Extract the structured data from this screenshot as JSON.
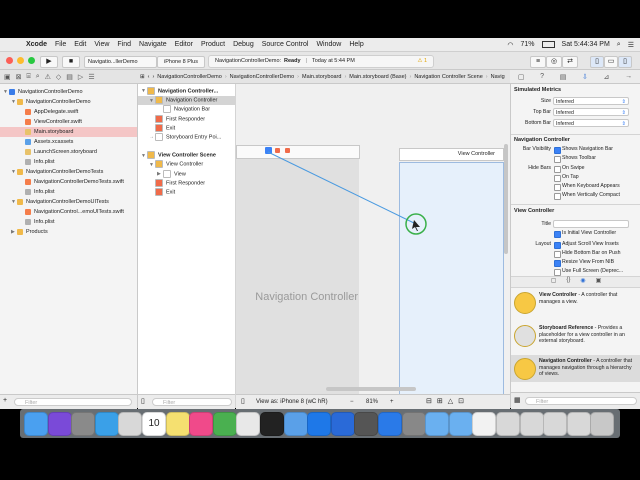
{
  "menubar": {
    "apple": "",
    "items": [
      "Xcode",
      "File",
      "Edit",
      "View",
      "Find",
      "Navigate",
      "Editor",
      "Product",
      "Debug",
      "Source Control",
      "Window",
      "Help"
    ],
    "battery": "71%",
    "clock": "Sat 5:44:34 PM"
  },
  "toolbar": {
    "run_icon": "▶",
    "stop_icon": "■",
    "scheme": "Navigatio...llerDemo",
    "device": "iPhone 8 Plus",
    "status_project": "NavigationControllerDemo:",
    "status_text": "Ready",
    "status_time": "Today at 5:44 PM",
    "warnings": "1"
  },
  "breadcrumb": {
    "items": [
      "NavigationControllerDemo",
      "NavigationControllerDemo",
      "Main.storyboard",
      "Main.storyboard (Base)",
      "Navigation Controller Scene",
      "Navigation Controller"
    ]
  },
  "navigator": {
    "rows": [
      {
        "label": "NavigationControllerDemo",
        "indent": 0,
        "icon_color": "#3b7de8",
        "selected": false,
        "disclosure": "▼"
      },
      {
        "label": "NavigationControllerDemo",
        "indent": 1,
        "icon_color": "#f0b94a",
        "selected": false,
        "disclosure": "▼"
      },
      {
        "label": "AppDelegate.swift",
        "indent": 2,
        "icon_color": "#f57d4a",
        "selected": false,
        "disclosure": ""
      },
      {
        "label": "ViewController.swift",
        "indent": 2,
        "icon_color": "#f57d4a",
        "selected": false,
        "disclosure": ""
      },
      {
        "label": "Main.storyboard",
        "indent": 2,
        "icon_color": "#e8c26a",
        "selected": true,
        "disclosure": ""
      },
      {
        "label": "Assets.xcassets",
        "indent": 2,
        "icon_color": "#5aa0e8",
        "selected": false,
        "disclosure": ""
      },
      {
        "label": "LaunchScreen.storyboard",
        "indent": 2,
        "icon_color": "#e8c26a",
        "selected": false,
        "disclosure": ""
      },
      {
        "label": "Info.plist",
        "indent": 2,
        "icon_color": "#b0b0b0",
        "selected": false,
        "disclosure": ""
      },
      {
        "label": "NavigationControllerDemoTests",
        "indent": 1,
        "icon_color": "#f0b94a",
        "selected": false,
        "disclosure": "▼"
      },
      {
        "label": "NavigationControllerDemoTests.swift",
        "indent": 2,
        "icon_color": "#f57d4a",
        "selected": false,
        "disclosure": ""
      },
      {
        "label": "Info.plist",
        "indent": 2,
        "icon_color": "#b0b0b0",
        "selected": false,
        "disclosure": ""
      },
      {
        "label": "NavigationControllerDemoUITests",
        "indent": 1,
        "icon_color": "#f0b94a",
        "selected": false,
        "disclosure": "▼"
      },
      {
        "label": "NavigationControl...emoUITests.swift",
        "indent": 2,
        "icon_color": "#f57d4a",
        "selected": false,
        "disclosure": ""
      },
      {
        "label": "Info.plist",
        "indent": 2,
        "icon_color": "#b0b0b0",
        "selected": false,
        "disclosure": ""
      },
      {
        "label": "Products",
        "indent": 1,
        "icon_color": "#f0b94a",
        "selected": false,
        "disclosure": "▶"
      }
    ],
    "filter_placeholder": "Filter"
  },
  "outline": {
    "rows": [
      {
        "label": "Navigation Controller...",
        "indent": 0,
        "icon_color": "#f0b94a",
        "selected": false,
        "disclosure": "▼",
        "bold": true
      },
      {
        "label": "Navigation Controller",
        "indent": 1,
        "icon_color": "#f0b94a",
        "selected": true,
        "disclosure": "▼",
        "bold": false
      },
      {
        "label": "Navigation Bar",
        "indent": 2,
        "icon_color": "#ffffff",
        "selected": false,
        "disclosure": "",
        "bold": false
      },
      {
        "label": "First Responder",
        "indent": 1,
        "icon_color": "#f06b4a",
        "selected": false,
        "disclosure": "",
        "bold": false
      },
      {
        "label": "Exit",
        "indent": 1,
        "icon_color": "#f06b4a",
        "selected": false,
        "disclosure": "",
        "bold": false
      },
      {
        "label": "Storyboard Entry Poi...",
        "indent": 1,
        "icon_color": "#ffffff",
        "selected": false,
        "disclosure": "→",
        "bold": false
      },
      {
        "label": "View Controller Scene",
        "indent": 0,
        "icon_color": "#f0b94a",
        "selected": false,
        "disclosure": "▼",
        "bold": true
      },
      {
        "label": "View Controller",
        "indent": 1,
        "icon_color": "#f0b94a",
        "selected": false,
        "disclosure": "▼",
        "bold": false
      },
      {
        "label": "View",
        "indent": 2,
        "icon_color": "#ffffff",
        "selected": false,
        "disclosure": "▶",
        "bold": false
      },
      {
        "label": "First Responder",
        "indent": 1,
        "icon_color": "#f06b4a",
        "selected": false,
        "disclosure": "",
        "bold": false
      },
      {
        "label": "Exit",
        "indent": 1,
        "icon_color": "#f06b4a",
        "selected": false,
        "disclosure": "",
        "bold": false
      }
    ],
    "filter_placeholder": "Filter"
  },
  "canvas": {
    "nav_scene_label": "Navigation Controller",
    "vc_title": "View Controller",
    "bottom": {
      "view_as": "View as: iPhone 8 (wC hR)",
      "zoom_out": "−",
      "zoom": "81%",
      "zoom_in": "+"
    }
  },
  "inspector": {
    "simulated_metrics": {
      "header": "Simulated Metrics",
      "rows": [
        {
          "label": "Size",
          "value": "Inferred"
        },
        {
          "label": "Top Bar",
          "value": "Inferred"
        },
        {
          "label": "Bottom Bar",
          "value": "Inferred"
        }
      ]
    },
    "navigation_controller": {
      "header": "Navigation Controller",
      "bar_visibility_label": "Bar Visibility",
      "shows_navigation_bar": "Shows Navigation Bar",
      "shows_toolbar": "Shows Toolbar",
      "hide_bars_label": "Hide Bars",
      "on_swipe": "On Swipe",
      "on_tap": "On Tap",
      "when_keyboard_appears": "When Keyboard Appears",
      "when_vertically_compact": "When Vertically Compact"
    },
    "view_controller": {
      "header": "View Controller",
      "title_label": "Title",
      "is_initial": "Is Initial View Controller",
      "layout_label": "Layout",
      "adjust_scroll": "Adjust Scroll View Insets",
      "hide_bottom_bar": "Hide Bottom Bar on Push",
      "resize_from_nib": "Resize View From NIB",
      "use_full_screen": "Use Full Screen (Deprec..."
    },
    "library": [
      {
        "title": "View Controller",
        "desc": " - A controller that manages a view.",
        "color": "#f7c844"
      },
      {
        "title": "Storyboard Reference",
        "desc": " - Provides a placeholder for a view controller in an external storyboard.",
        "color": "#e0e0e0"
      },
      {
        "title": "Navigation Controller",
        "desc": " - A controller that manages navigation through a hierarchy of views.",
        "color": "#f7c844"
      }
    ],
    "filter_placeholder": "Filter"
  },
  "dock": {
    "icons": [
      {
        "name": "finder-icon",
        "color": "#4aa0f0"
      },
      {
        "name": "siri-icon",
        "color": "#7a4ad8"
      },
      {
        "name": "launchpad-icon",
        "color": "#8a8a8a"
      },
      {
        "name": "safari-icon",
        "color": "#3aa0e8"
      },
      {
        "name": "mail-icon",
        "color": "#d8d8d8"
      },
      {
        "name": "calendar-icon",
        "color": "#ffffff"
      },
      {
        "name": "notes-icon",
        "color": "#f5e070"
      },
      {
        "name": "itunes-icon",
        "color": "#f04a8a"
      },
      {
        "name": "chrome-icon",
        "color": "#4ab050"
      },
      {
        "name": "photos-icon",
        "color": "#e8e8e8"
      },
      {
        "name": "terminal-icon",
        "color": "#222222"
      },
      {
        "name": "preview-icon",
        "color": "#5aa0e8"
      },
      {
        "name": "app-store-icon",
        "color": "#1e78e8"
      },
      {
        "name": "cortana-icon",
        "color": "#2a6ad8"
      },
      {
        "name": "sublime-icon",
        "color": "#555555"
      },
      {
        "name": "xcode-icon",
        "color": "#2a7ae8"
      },
      {
        "name": "system-preferences-icon",
        "color": "#888888"
      },
      {
        "name": "folder-icon",
        "color": "#6ab0f0"
      },
      {
        "name": "downloads-icon",
        "color": "#6ab0f0"
      },
      {
        "name": "document-icon",
        "color": "#f2f2f2"
      },
      {
        "name": "screenshot-icon",
        "color": "#d8d8d8"
      },
      {
        "name": "screenshot-icon-2",
        "color": "#d8d8d8"
      },
      {
        "name": "screenshot-icon-3",
        "color": "#d8d8d8"
      },
      {
        "name": "screenshot-icon-4",
        "color": "#d8d8d8"
      },
      {
        "name": "trash-icon",
        "color": "#c8c8c8"
      }
    ],
    "calendar_day": "10"
  }
}
